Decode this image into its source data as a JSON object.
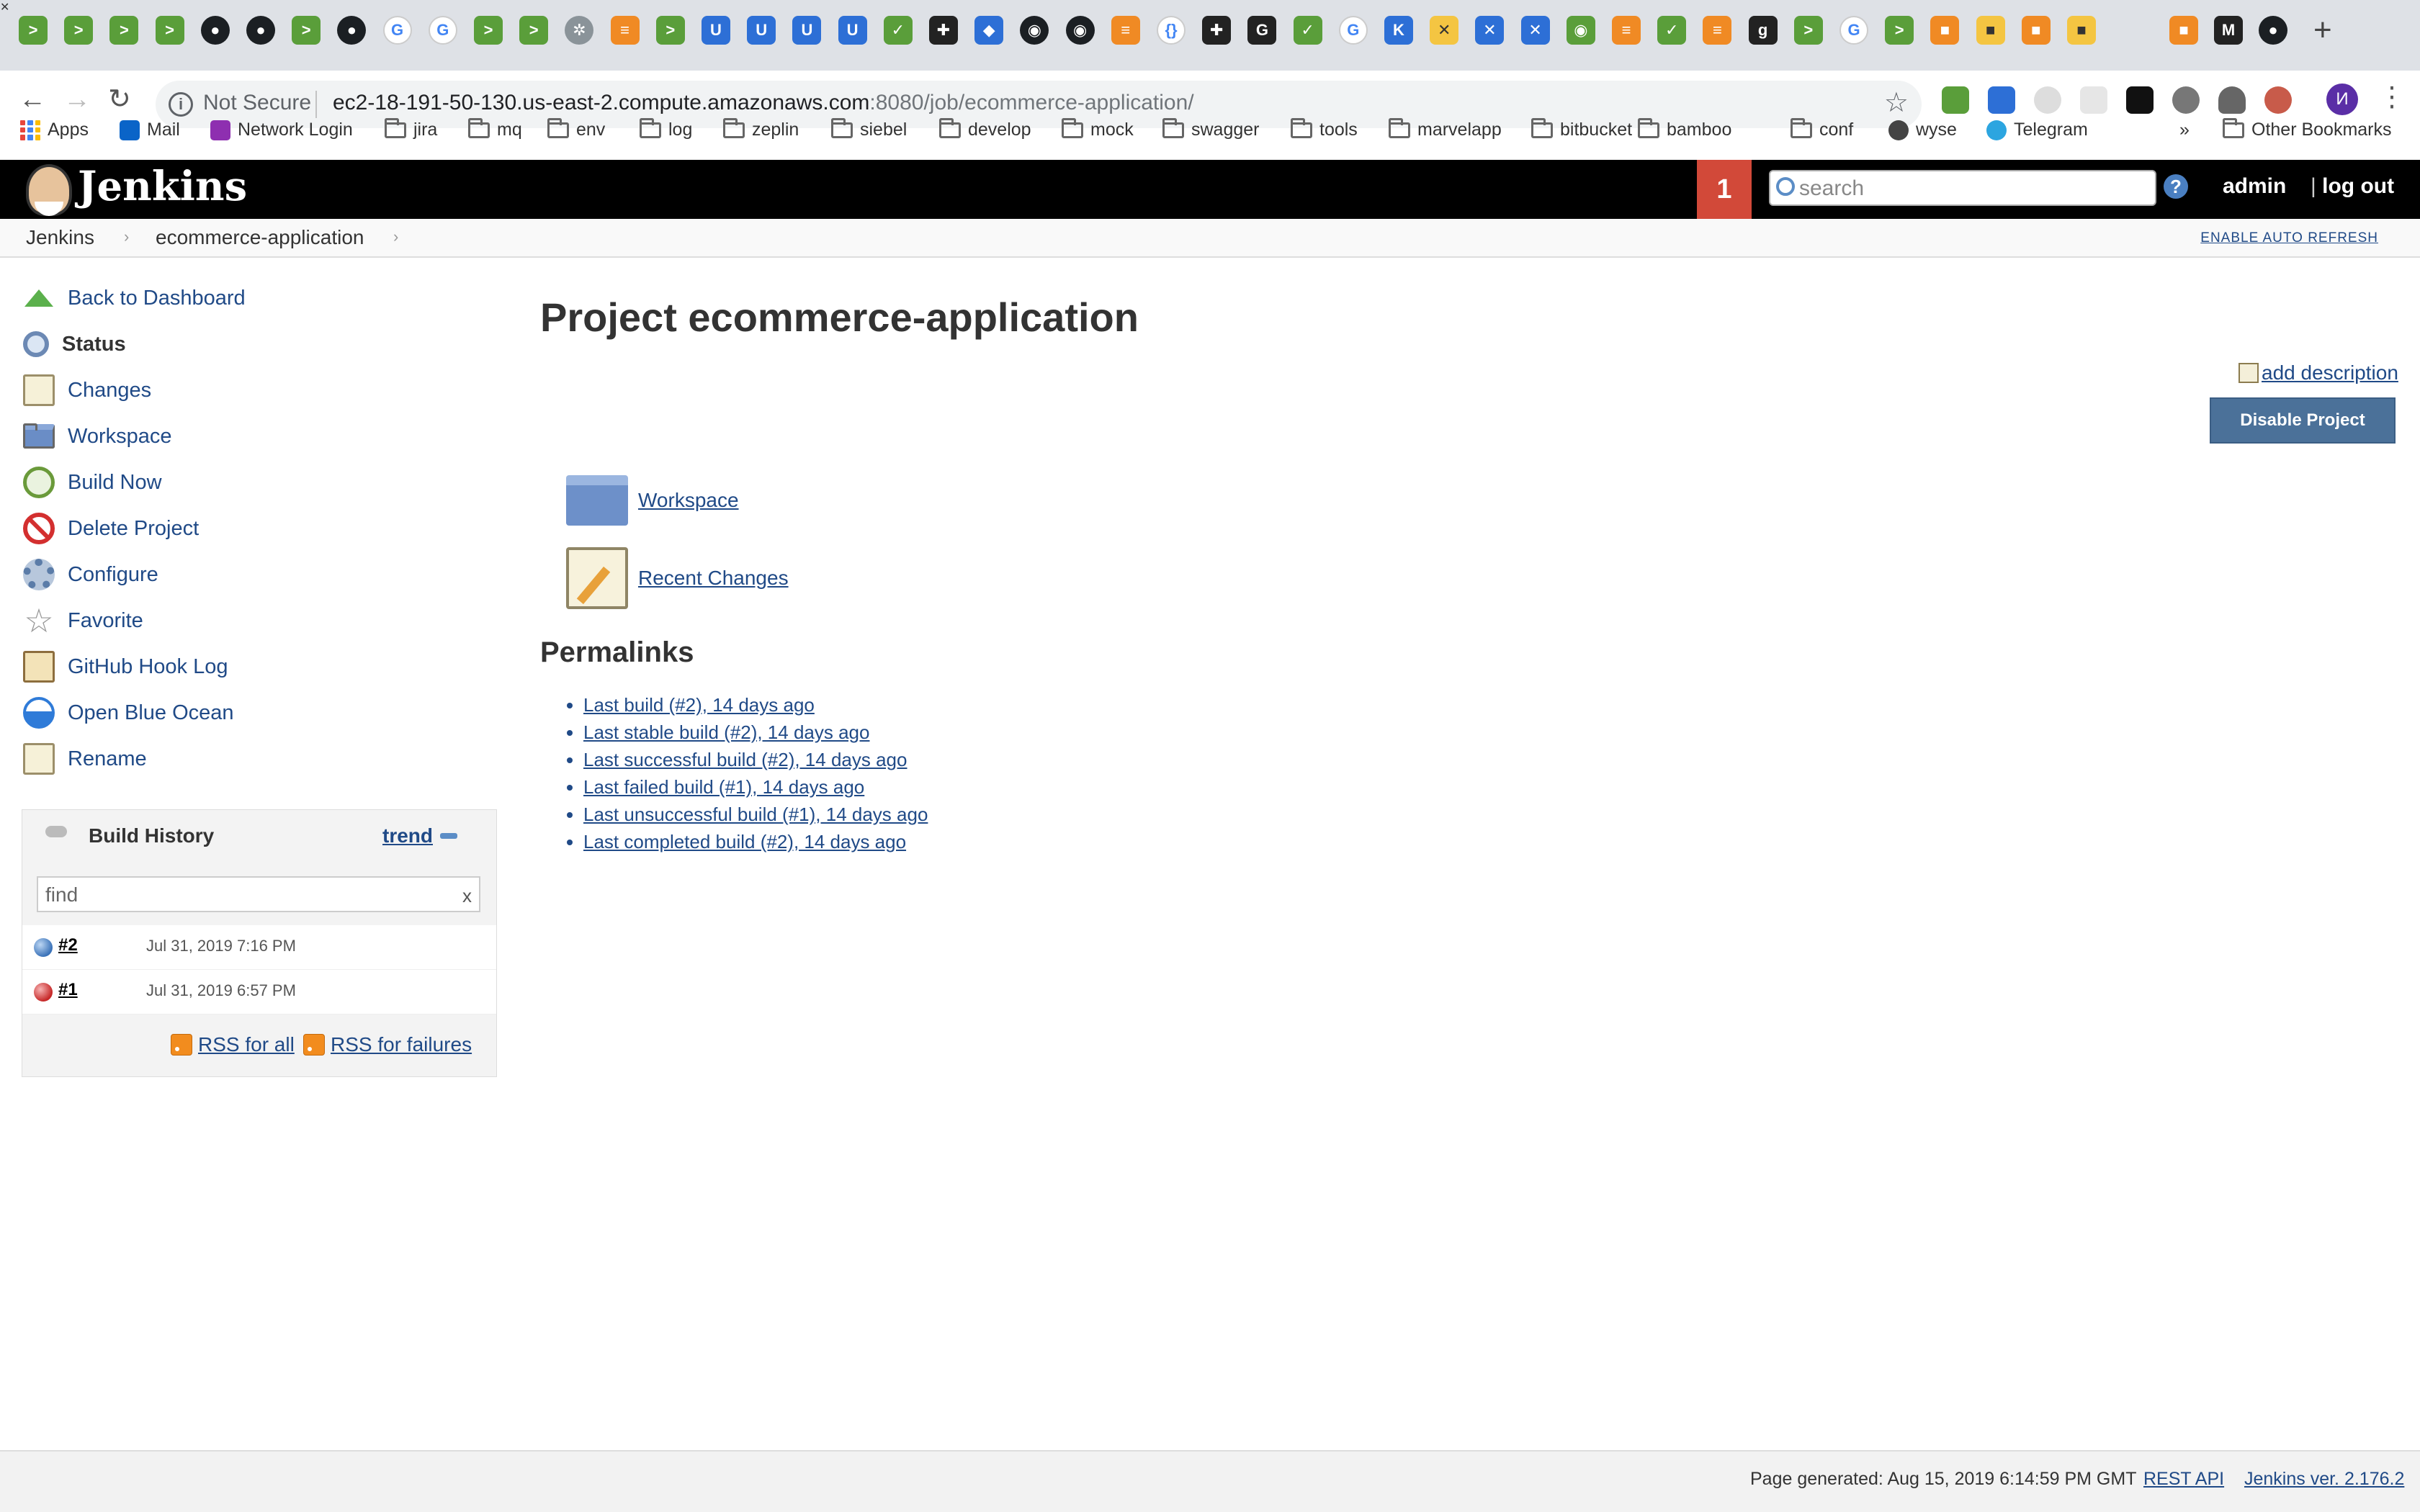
{
  "browser": {
    "tabs": [
      {
        "icon": "jenkins-icon",
        "glyph": ">",
        "style": "jk"
      },
      {
        "icon": "jenkins-icon",
        "glyph": ">",
        "style": "jk"
      },
      {
        "icon": "jenkins-icon",
        "glyph": ">",
        "style": "jk"
      },
      {
        "icon": "jenkins-icon",
        "glyph": ">",
        "style": "jk"
      },
      {
        "icon": "github-icon",
        "glyph": "●",
        "style": "gh"
      },
      {
        "icon": "github-icon",
        "glyph": "●",
        "style": "gh"
      },
      {
        "icon": "jenkins-icon",
        "glyph": ">",
        "style": "jk"
      },
      {
        "icon": "github-icon",
        "glyph": "●",
        "style": "gh"
      },
      {
        "icon": "google-icon",
        "glyph": "G",
        "style": "gg"
      },
      {
        "icon": "google-icon",
        "glyph": "G",
        "style": "gg"
      },
      {
        "icon": "jenkins-icon",
        "glyph": ">",
        "style": "jk"
      },
      {
        "icon": "jenkins-icon",
        "glyph": ">",
        "style": "jk"
      },
      {
        "icon": "settings-icon",
        "glyph": "✲",
        "style": "gr"
      },
      {
        "icon": "stackoverflow-icon",
        "glyph": "≡",
        "style": "or"
      },
      {
        "icon": "jenkins-icon",
        "glyph": ">",
        "style": "jk"
      },
      {
        "icon": "confluence-icon",
        "glyph": "U",
        "style": "bl"
      },
      {
        "icon": "confluence-icon",
        "glyph": "U",
        "style": "bl"
      },
      {
        "icon": "confluence-icon",
        "glyph": "U",
        "style": "bl"
      },
      {
        "icon": "confluence-icon",
        "glyph": "U",
        "style": "bl"
      },
      {
        "icon": "spring-icon",
        "glyph": "✓",
        "style": "jk"
      },
      {
        "icon": "tool-icon",
        "glyph": "✚",
        "style": "dk"
      },
      {
        "icon": "bitwarden-icon",
        "glyph": "◆",
        "style": "bl"
      },
      {
        "icon": "globe-icon",
        "glyph": "◉",
        "style": "gh"
      },
      {
        "icon": "globe-icon",
        "glyph": "◉",
        "style": "gh"
      },
      {
        "icon": "stackoverflow-icon",
        "glyph": "≡",
        "style": "or"
      },
      {
        "icon": "json-icon",
        "glyph": "{}",
        "style": "gg"
      },
      {
        "icon": "tool-icon",
        "glyph": "✚",
        "style": "dk"
      },
      {
        "icon": "g-icon",
        "glyph": "G",
        "style": "dk"
      },
      {
        "icon": "spring-icon",
        "glyph": "✓",
        "style": "jk"
      },
      {
        "icon": "google-icon",
        "glyph": "G",
        "style": "gg"
      },
      {
        "icon": "kotlin-icon",
        "glyph": "K",
        "style": "bl"
      },
      {
        "icon": "close-box-icon",
        "glyph": "✕",
        "style": "yl"
      },
      {
        "icon": "confluence-icon",
        "glyph": "✕",
        "style": "bl"
      },
      {
        "icon": "confluence-icon",
        "glyph": "✕",
        "style": "bl"
      },
      {
        "icon": "spring-icon",
        "glyph": "◉",
        "style": "jk"
      },
      {
        "icon": "stackoverflow-icon",
        "glyph": "≡",
        "style": "or"
      },
      {
        "icon": "spring-icon",
        "glyph": "✓",
        "style": "jk"
      },
      {
        "icon": "stackoverflow-icon",
        "glyph": "≡",
        "style": "or"
      },
      {
        "icon": "g-icon",
        "glyph": "g",
        "style": "dk"
      },
      {
        "icon": "jenkins-icon",
        "glyph": ">",
        "style": "jk"
      },
      {
        "icon": "google-icon",
        "glyph": "G",
        "style": "gg"
      },
      {
        "icon": "jenkins-icon",
        "glyph": ">",
        "style": "jk"
      },
      {
        "icon": "package-icon",
        "glyph": "■",
        "style": "or"
      },
      {
        "icon": "package-icon",
        "glyph": "■",
        "style": "yl"
      },
      {
        "icon": "package-icon",
        "glyph": "■",
        "style": "or"
      },
      {
        "icon": "package-icon",
        "glyph": "■",
        "style": "yl"
      }
    ],
    "tabs_after_active": [
      {
        "icon": "package-icon",
        "glyph": "■",
        "style": "or"
      },
      {
        "icon": "medium-icon",
        "glyph": "M",
        "style": "dk"
      },
      {
        "icon": "github-icon",
        "glyph": "●",
        "style": "gh"
      }
    ],
    "active_tab_close": "✕",
    "new_tab": "+",
    "address": {
      "security": "Not Secure",
      "host": "ec2-18-191-50-130.us-east-2.compute.amazonaws.com",
      "path": ":8080/job/ecommerce-application/"
    },
    "profile_initial": "И",
    "bookmarks": [
      {
        "label": "Apps",
        "icon": "apps-grid"
      },
      {
        "label": "Mail",
        "icon": "outlook-icon"
      },
      {
        "label": "Network Login",
        "icon": "umbrella-icon"
      },
      {
        "label": "jira",
        "icon": "folder-icon"
      },
      {
        "label": "mq",
        "icon": "folder-icon"
      },
      {
        "label": "env",
        "icon": "folder-icon"
      },
      {
        "label": "log",
        "icon": "folder-icon"
      },
      {
        "label": "zeplin",
        "icon": "folder-icon"
      },
      {
        "label": "siebel",
        "icon": "folder-icon"
      },
      {
        "label": "develop",
        "icon": "folder-icon"
      },
      {
        "label": "mock",
        "icon": "folder-icon"
      },
      {
        "label": "swagger",
        "icon": "folder-icon"
      },
      {
        "label": "tools",
        "icon": "folder-icon"
      },
      {
        "label": "marvelapp",
        "icon": "folder-icon"
      },
      {
        "label": "bitbucket",
        "icon": "folder-icon"
      },
      {
        "label": "bamboo",
        "icon": "folder-icon"
      },
      {
        "label": "conf",
        "icon": "folder-icon"
      },
      {
        "label": "wyse",
        "icon": "fingerprint-icon"
      },
      {
        "label": "Telegram",
        "icon": "telegram-icon"
      }
    ],
    "bookmarks_overflow": "»",
    "other_bookmarks": "Other Bookmarks"
  },
  "jenkins": {
    "brand": "Jenkins",
    "notification_count": "1",
    "search_placeholder": "search",
    "help": "?",
    "user": "admin",
    "logout": "log out",
    "breadcrumb": [
      "Jenkins",
      "ecommerce-application"
    ],
    "enable_auto_refresh": "ENABLE AUTO REFRESH",
    "tasks": [
      {
        "label": "Back to Dashboard",
        "icon": "up-arrow-icon",
        "cls": "arrow",
        "bold": false
      },
      {
        "label": "Status",
        "icon": "search-icon",
        "cls": "mag",
        "bold": true
      },
      {
        "label": "Changes",
        "icon": "notepad-icon",
        "cls": "notepad",
        "bold": false
      },
      {
        "label": "Workspace",
        "icon": "folder-icon",
        "cls": "folder",
        "bold": false
      },
      {
        "label": "Build Now",
        "icon": "clock-icon",
        "cls": "clock",
        "bold": false
      },
      {
        "label": "Delete Project",
        "icon": "no-entry-icon",
        "cls": "nosign",
        "bold": false
      },
      {
        "label": "Configure",
        "icon": "gear-icon",
        "cls": "gear",
        "bold": false
      },
      {
        "label": "Favorite",
        "icon": "star-icon",
        "cls": "star",
        "bold": false
      },
      {
        "label": "GitHub Hook Log",
        "icon": "clipboard-icon",
        "cls": "clip",
        "bold": false
      },
      {
        "label": "Open Blue Ocean",
        "icon": "blue-ocean-icon",
        "cls": "ocean",
        "bold": false
      },
      {
        "label": "Rename",
        "icon": "notepad-icon",
        "cls": "notepad",
        "bold": false
      }
    ],
    "build_history": {
      "title": "Build History",
      "trend": "trend",
      "find_placeholder": "find",
      "clear": "x",
      "builds": [
        {
          "number": "#2",
          "date": "Jul 31, 2019 7:16 PM",
          "status": "blue"
        },
        {
          "number": "#1",
          "date": "Jul 31, 2019 6:57 PM",
          "status": "red"
        }
      ],
      "rss_all": "RSS for all",
      "rss_failures": "RSS for failures"
    },
    "project": {
      "title": "Project ecommerce-application",
      "add_description": "add description",
      "disable_button": "Disable Project",
      "workspace_link": "Workspace",
      "recent_changes_link": "Recent Changes",
      "permalinks_heading": "Permalinks",
      "permalinks": [
        "Last build (#2), 14 days ago",
        "Last stable build (#2), 14 days ago",
        "Last successful build (#2), 14 days ago",
        "Last failed build (#1), 14 days ago",
        "Last unsuccessful build (#1), 14 days ago",
        "Last completed build (#2), 14 days ago"
      ]
    },
    "footer": {
      "generated": "Page generated: Aug 15, 2019 6:14:59 PM GMT",
      "rest_api": "REST API",
      "version": "Jenkins ver. 2.176.2"
    }
  },
  "colors": {
    "header_bg": "#000000",
    "notification_bg": "#d24939",
    "link": "#204a87",
    "disable_button_bg": "#4b7199"
  }
}
